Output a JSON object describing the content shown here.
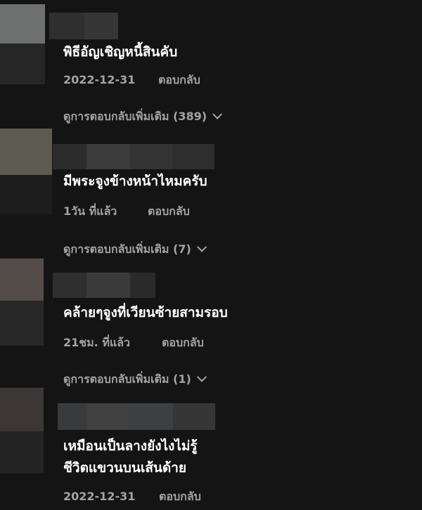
{
  "comments": [
    {
      "text_lines": [
        "พิธีอัญเชิญหนี้สินคับ"
      ],
      "time": "2022-12-31",
      "reply_label": "ตอบกลับ",
      "more_replies": "ดูการตอบกลับเพิ่มเติม (389)",
      "avatar_colors": [
        "#6d706f",
        "#262626"
      ],
      "name_block_colors": [
        "#2f2f2f",
        "#363636"
      ]
    },
    {
      "text_lines": [
        "มีพระจูงข้างหน้าไหมครับ"
      ],
      "time": "1วัน ที่แล้ว",
      "reply_label": "ตอบกลับ",
      "more_replies": "ดูการตอบกลับเพิ่มเติม (7)",
      "avatar_colors": [
        "#5d5a52",
        "#1d1d1d"
      ],
      "name_block_colors": [
        "#2c2c2c",
        "#3b3b3b",
        "#333333",
        "#2e2e2e"
      ]
    },
    {
      "text_lines": [
        "คล้ายๆจูงที่เวียนซ้ายสามรอบ"
      ],
      "time": "21ชม. ที่แล้ว",
      "reply_label": "ตอบกลับ",
      "more_replies": "ดูการตอบกลับเพิ่มเติม (1)",
      "avatar_colors": [
        "#524b47",
        "#282828"
      ],
      "name_block_colors": [
        "#2f2f2f",
        "#343434",
        "#3a3a3a",
        "#2a2a2a"
      ]
    },
    {
      "text_lines": [
        "เหมือนเป็นลางยังไงไม่รู้",
        "ชีวิตแขวนบนเส้นด้าย"
      ],
      "time": "2022-12-31",
      "reply_label": "ตอบกลับ",
      "avatar_colors": [
        "#3d3637",
        "#242424"
      ],
      "name_block_colors": [
        "#393a3c",
        "#404040",
        "#3e3f41",
        "#363636"
      ]
    }
  ]
}
